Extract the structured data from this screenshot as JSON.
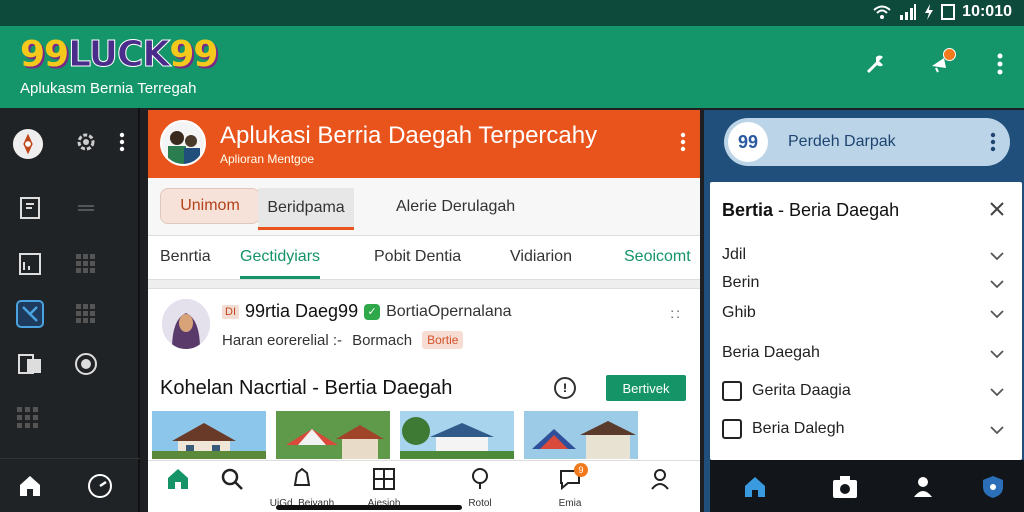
{
  "status_bar": {
    "time": "10:010"
  },
  "app_bar": {
    "logo": {
      "left": "99",
      "middle": "LUCK",
      "right": "99"
    },
    "tagline": "Aplukasm Bernia Terregah",
    "actions": [
      "tool-icon",
      "notification-icon",
      "more-icon"
    ]
  },
  "left_rail": {
    "icons": [
      "compass-icon",
      "settings-icon",
      "more-icon",
      "bookmark-icon",
      "list-icon",
      "chart-icon",
      "grid-icon",
      "shuffle-icon",
      "grid-icon",
      "map-icon",
      "eye-icon",
      "grid-icon",
      "home-icon",
      "clock-icon"
    ]
  },
  "center": {
    "header": {
      "title": "Aplukasi Berria Daegah Terpercahy",
      "subtitle": "Aplioran Mentgoe"
    },
    "segments": {
      "first": "Unimom",
      "second": "Beridpama",
      "third": "Alerie Derulagah"
    },
    "tabs": [
      "Benrtia",
      "Gectidyiars",
      "Pobit Dentia",
      "Vidiarion",
      "Seoicomt"
    ],
    "card": {
      "tag": "DI",
      "name": "99rtia Daeg99",
      "publisher": "BortiaOpernalana",
      "meta": "Haran eorerelial :-",
      "author": "Bormach",
      "pill": "Bortie",
      "more": "::",
      "headline": "Kohelan Nacrtial - Bertia Daegah",
      "info": "!",
      "button": "Bertivek"
    },
    "bottom_nav": [
      {
        "icon": "home-icon",
        "label": ""
      },
      {
        "icon": "search-icon",
        "label": ""
      },
      {
        "icon": "bell-icon",
        "label": "UiGd. Beiyanh"
      },
      {
        "icon": "grid-icon",
        "label": "Aiesioh"
      },
      {
        "icon": "search-icon",
        "label": "Rotol"
      },
      {
        "icon": "chat-icon",
        "label": "Emia",
        "badge": "9"
      },
      {
        "icon": "user-icon",
        "label": ""
      }
    ]
  },
  "right": {
    "search": {
      "badge": "99",
      "text": "Perdeh Darpak"
    },
    "dialog": {
      "title_bold": "Bertia",
      "title_rest": "- Beria Daegah",
      "rows": [
        "Jdil",
        "Berin",
        "Ghib",
        "Beria Daegah",
        "Gerita Daagia",
        "Beria Dalegh"
      ]
    },
    "bottom_nav": [
      "home-icon",
      "camera-icon",
      "user-icon",
      "shield-icon"
    ]
  },
  "colors": {
    "brand_green": "#14966a",
    "orange": "#e8541c",
    "blue": "#1f4f7a"
  }
}
